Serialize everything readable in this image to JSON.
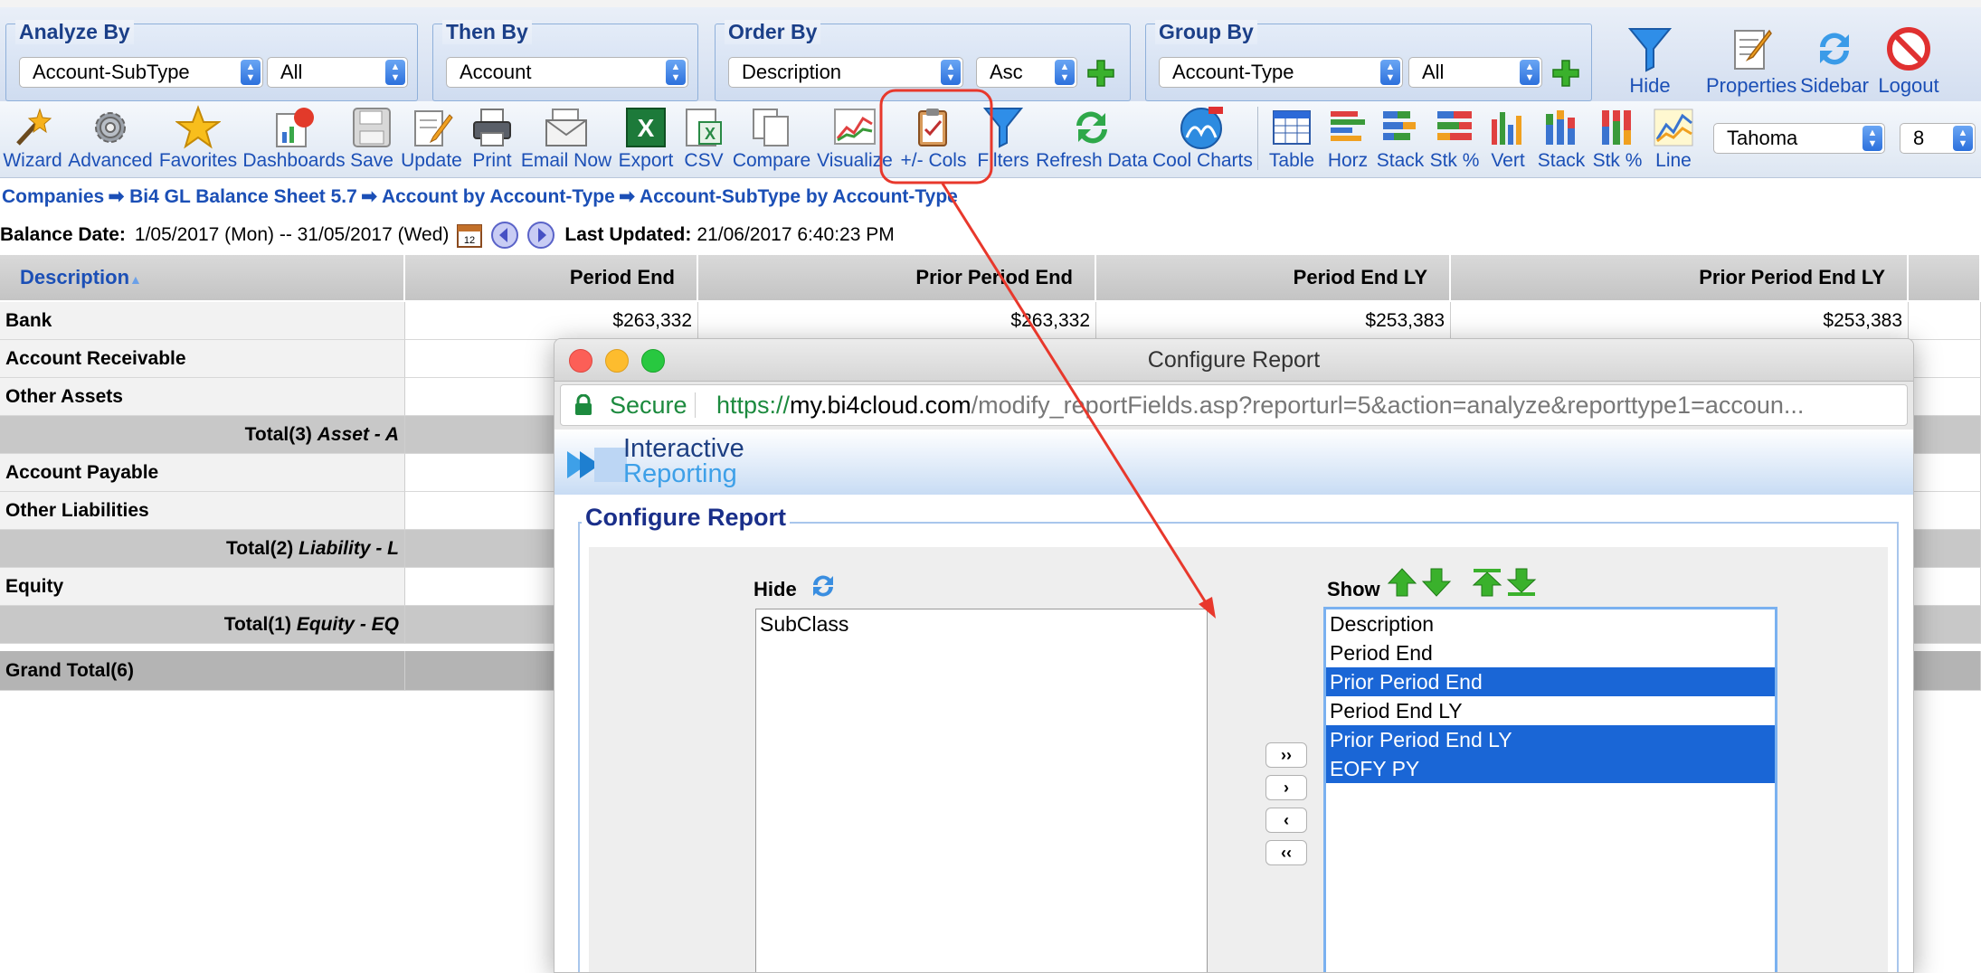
{
  "filters": {
    "analyze_by": {
      "label": "Analyze By",
      "field": "Account-SubType",
      "value": "All"
    },
    "then_by": {
      "label": "Then By",
      "field": "Account"
    },
    "order_by": {
      "label": "Order By",
      "field": "Description",
      "direction": "Asc"
    },
    "group_by": {
      "label": "Group By",
      "field": "Account-Type",
      "value": "All"
    }
  },
  "top_actions": [
    "Hide Filters",
    "Properties",
    "Sidebar",
    "Logout"
  ],
  "toolbar": {
    "items": [
      "Wizard",
      "Advanced",
      "Favorites",
      "Dashboards",
      "Save",
      "Update",
      "Print",
      "Email Now",
      "Export",
      "CSV",
      "Compare",
      "Visualize",
      "+/- Cols",
      "Filters",
      "Refresh Data",
      "Cool Charts"
    ],
    "chart_items": [
      "Table",
      "Horz",
      "Stack",
      "Stk %",
      "Vert",
      "Stack",
      "Stk %",
      "Line"
    ],
    "font": "Tahoma",
    "font_size": "8"
  },
  "breadcrumb": [
    "Companies",
    "Bi4 GL Balance Sheet 5.7",
    "Account by Account-Type",
    "Account-SubType by Account-Type"
  ],
  "balance": {
    "label": "Balance Date:",
    "range": "1/05/2017 (Mon) -- 31/05/2017 (Wed)",
    "updated_label": "Last Updated:",
    "updated": "21/06/2017 6:40:23 PM"
  },
  "grid": {
    "columns": [
      "Description",
      "Period End",
      "Prior Period End",
      "Period End LY",
      "Prior Period End LY"
    ],
    "rows": [
      {
        "label": "Bank",
        "type": "row",
        "values": [
          "$263,332",
          "$263,332",
          "$253,383",
          "$253,383"
        ]
      },
      {
        "label": "Account Receivable",
        "type": "row"
      },
      {
        "label": "Other Assets",
        "type": "row"
      },
      {
        "label": "Total(3)",
        "type": "total",
        "suffix": "Asset - A"
      },
      {
        "label": "Account Payable",
        "type": "row"
      },
      {
        "label": "Other Liabilities",
        "type": "row"
      },
      {
        "label": "Total(2)",
        "type": "total",
        "suffix": "Liability - L"
      },
      {
        "label": "Equity",
        "type": "row"
      },
      {
        "label": "Total(1)",
        "type": "total",
        "suffix": "Equity - EQ"
      },
      {
        "label": "Grand Total(6)",
        "type": "grand"
      }
    ]
  },
  "modal": {
    "window_title": "Configure Report",
    "secure": "Secure",
    "url_scheme": "https://",
    "url_host": "my.bi4cloud.com",
    "url_path": "/modify_reportFields.asp?reporturl=5&action=analyze&reporttype1=accoun...",
    "brand_line1": "Interactive",
    "brand_line2": "Reporting",
    "section_title": "Configure Report",
    "hide_label": "Hide",
    "show_label": "Show",
    "hide_items": [
      "SubClass"
    ],
    "show_items": [
      {
        "text": "Description",
        "selected": false
      },
      {
        "text": "Period End",
        "selected": false
      },
      {
        "text": "Prior Period End",
        "selected": true
      },
      {
        "text": "Period End LY",
        "selected": false
      },
      {
        "text": "Prior Period End LY",
        "selected": true
      },
      {
        "text": "EOFY PY",
        "selected": true
      }
    ],
    "move_buttons": [
      "››",
      "›",
      "‹",
      "‹‹"
    ]
  },
  "colors": {
    "accent": "#1b4fb6",
    "selection": "#1a66d6",
    "annotation": "#e8382c"
  }
}
